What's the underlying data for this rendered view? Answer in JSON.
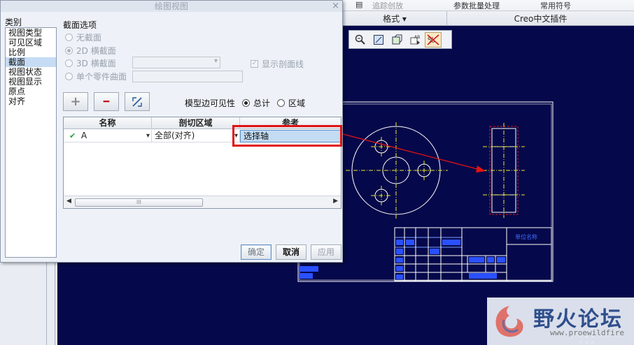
{
  "dialog": {
    "title": "绘图视图",
    "close_glyph": "×",
    "category_label": "类别",
    "categories": [
      "视图类型",
      "可见区域",
      "比例",
      "截面",
      "视图状态",
      "视图显示",
      "原点",
      "对齐"
    ],
    "selected_category": "截面",
    "section_options_label": "截面选项",
    "radio_options": [
      "无截面",
      "2D 横截面",
      "3D 横截面",
      "单个零件曲面"
    ],
    "selected_radio": "2D 横截面",
    "show_hatch_label": "显示剖面线",
    "add_glyph": "+",
    "remove_glyph": "━",
    "edge_visibility_label": "模型边可见性",
    "edge_visibility_options": [
      "总计",
      "区域"
    ],
    "edge_visibility_selected": "总计",
    "table": {
      "headers": [
        "名称",
        "剖切区域",
        "参考"
      ],
      "row": {
        "check": "✔",
        "name": "A",
        "region": "全部(对齐)",
        "reference": "选择轴"
      },
      "scroll_thumb": "III"
    },
    "buttons": {
      "ok": "确定",
      "cancel": "取消",
      "apply": "应用"
    }
  },
  "ribbon": {
    "top_items": [
      "追踪创放",
      "参数批量处理",
      "常用符号"
    ],
    "groups": [
      "格式 ▾",
      "Creo中文插件"
    ]
  },
  "view_toolbar": {
    "icons": [
      "zoom-in-icon",
      "zoom-window-icon",
      "refit-icon",
      "repaint-icon",
      "annotation-display-icon",
      "display-toggle-icon"
    ]
  },
  "drawing": {
    "title_block_text": "单位名称",
    "accent_colors": {
      "background": "#05084a",
      "lines": "#ffffff",
      "centerlines": "#e6e62a",
      "arrow": "#e21313",
      "table_cells": "#2a50ff"
    }
  },
  "watermark": {
    "title": "野火论坛",
    "url": "www.proewildfire"
  }
}
